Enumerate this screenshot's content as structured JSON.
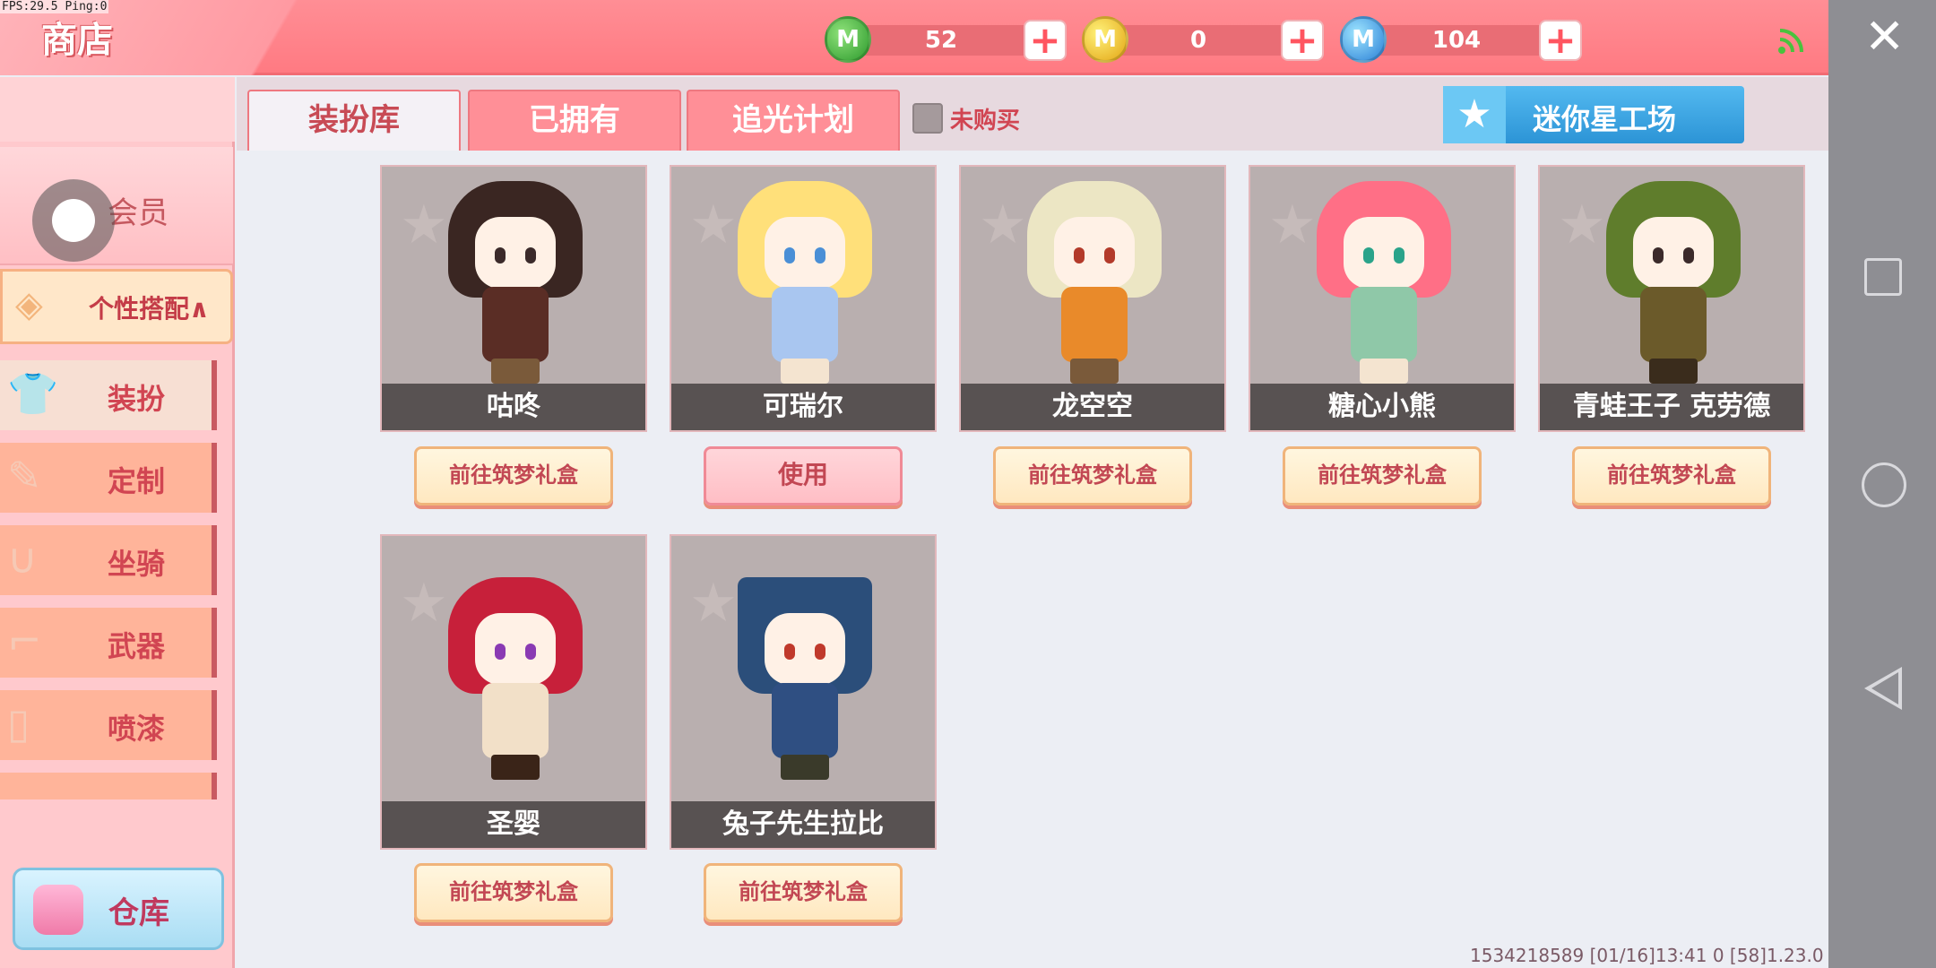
{
  "debug": {
    "fps": "FPS:29.5  Ping:0"
  },
  "header": {
    "title": "商店",
    "currencies": [
      {
        "name": "green-coin",
        "symbol": "M",
        "amount": "52"
      },
      {
        "name": "gold-coin",
        "symbol": "M",
        "amount": "0"
      },
      {
        "name": "blue-coin",
        "symbol": "M",
        "amount": "104"
      }
    ],
    "plus": "+"
  },
  "sidebar": {
    "vip": "会员",
    "personal": "个性搭配∧",
    "items": [
      {
        "label": "装扮",
        "icon": "shirt-icon",
        "active": true
      },
      {
        "label": "定制",
        "icon": "pencil-icon"
      },
      {
        "label": "坐骑",
        "icon": "saddle-icon"
      },
      {
        "label": "武器",
        "icon": "gun-icon"
      },
      {
        "label": "喷漆",
        "icon": "spray-can-icon"
      }
    ],
    "warehouse": "仓库"
  },
  "tabs": [
    {
      "label": "装扮库",
      "active": true
    },
    {
      "label": "已拥有"
    },
    {
      "label": "追光计划"
    }
  ],
  "filter": {
    "label": "未购买"
  },
  "mini_workshop": {
    "label": "迷你星工场"
  },
  "cards": [
    {
      "name": "咕咚",
      "button": "前往筑梦礼盒",
      "hair": "#3a2622",
      "body": "#5a2d25"
    },
    {
      "name": "可瑞尔",
      "button": "使用",
      "hair": "#ffe07a",
      "body": "#a9c6f0"
    },
    {
      "name": "龙空空",
      "button": "前往筑梦礼盒",
      "hair": "#ece6c4",
      "body": "#e98a2a"
    },
    {
      "name": "糖心小熊",
      "button": "前往筑梦礼盒",
      "hair": "#ff6f86",
      "body": "#8fc8a8"
    },
    {
      "name": "青蛙王子 克劳德",
      "button": "前往筑梦礼盒",
      "hair": "#5f7d2c",
      "body": "#6b5a2a"
    },
    {
      "name": "圣婴",
      "button": "前往筑梦礼盒",
      "hair": "#c7203a",
      "body": "#f2e0c8"
    },
    {
      "name": "兔子先生拉比",
      "button": "前往筑梦礼盒",
      "hair": "#2b4e7a",
      "body": "#2f4f82"
    }
  ],
  "footer": "1534218589   [01/16]13:41 0     [58]1.23.0"
}
